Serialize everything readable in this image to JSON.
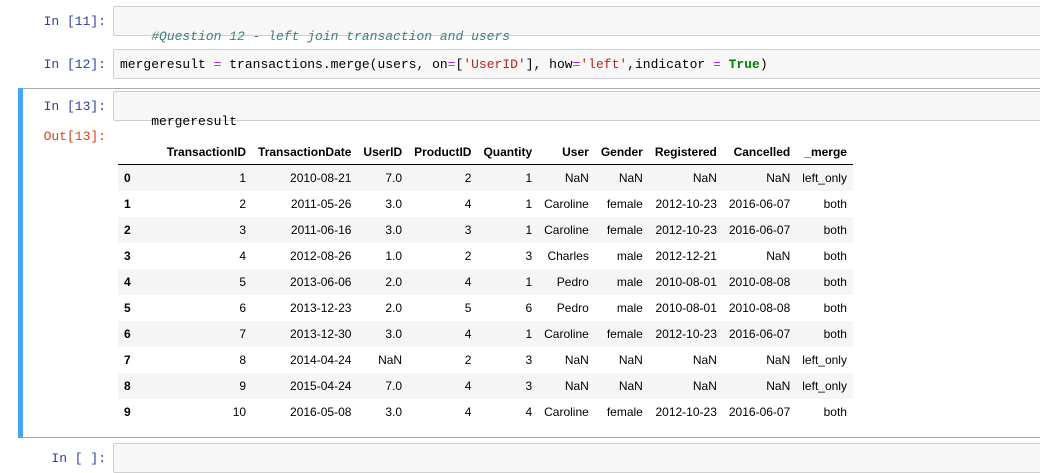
{
  "cells": [
    {
      "prompt": "In [11]:",
      "comment": "#Question 12 - left join transaction and users"
    },
    {
      "prompt": "In [12]:"
    },
    {
      "prompt": "In [13]:",
      "code": "mergeresult",
      "out_prompt": "Out[13]:"
    },
    {
      "prompt": "In [ ]:"
    }
  ],
  "code12": {
    "var": "mergeresult ",
    "eq": "=",
    "call": " transactions.merge(users, on",
    "eq2": "=",
    "bracket_open": "[",
    "on_str": "'UserID'",
    "bracket_close": "], how",
    "eq3": "=",
    "how_str": "'left'",
    "indicator": ",indicator ",
    "eq4": "=",
    "true_kw": " True",
    "close": ")"
  },
  "table": {
    "columns": [
      "",
      "TransactionID",
      "TransactionDate",
      "UserID",
      "ProductID",
      "Quantity",
      "User",
      "Gender",
      "Registered",
      "Cancelled",
      "_merge"
    ],
    "rows": [
      [
        "0",
        "1",
        "2010-08-21",
        "7.0",
        "2",
        "1",
        "NaN",
        "NaN",
        "NaN",
        "NaN",
        "left_only"
      ],
      [
        "1",
        "2",
        "2011-05-26",
        "3.0",
        "4",
        "1",
        "Caroline",
        "female",
        "2012-10-23",
        "2016-06-07",
        "both"
      ],
      [
        "2",
        "3",
        "2011-06-16",
        "3.0",
        "3",
        "1",
        "Caroline",
        "female",
        "2012-10-23",
        "2016-06-07",
        "both"
      ],
      [
        "3",
        "4",
        "2012-08-26",
        "1.0",
        "2",
        "3",
        "Charles",
        "male",
        "2012-12-21",
        "NaN",
        "both"
      ],
      [
        "4",
        "5",
        "2013-06-06",
        "2.0",
        "4",
        "1",
        "Pedro",
        "male",
        "2010-08-01",
        "2010-08-08",
        "both"
      ],
      [
        "5",
        "6",
        "2013-12-23",
        "2.0",
        "5",
        "6",
        "Pedro",
        "male",
        "2010-08-01",
        "2010-08-08",
        "both"
      ],
      [
        "6",
        "7",
        "2013-12-30",
        "3.0",
        "4",
        "1",
        "Caroline",
        "female",
        "2012-10-23",
        "2016-06-07",
        "both"
      ],
      [
        "7",
        "8",
        "2014-04-24",
        "NaN",
        "2",
        "3",
        "NaN",
        "NaN",
        "NaN",
        "NaN",
        "left_only"
      ],
      [
        "8",
        "9",
        "2015-04-24",
        "7.0",
        "4",
        "3",
        "NaN",
        "NaN",
        "NaN",
        "NaN",
        "left_only"
      ],
      [
        "9",
        "10",
        "2016-05-08",
        "3.0",
        "4",
        "4",
        "Caroline",
        "female",
        "2012-10-23",
        "2016-06-07",
        "both"
      ]
    ]
  }
}
